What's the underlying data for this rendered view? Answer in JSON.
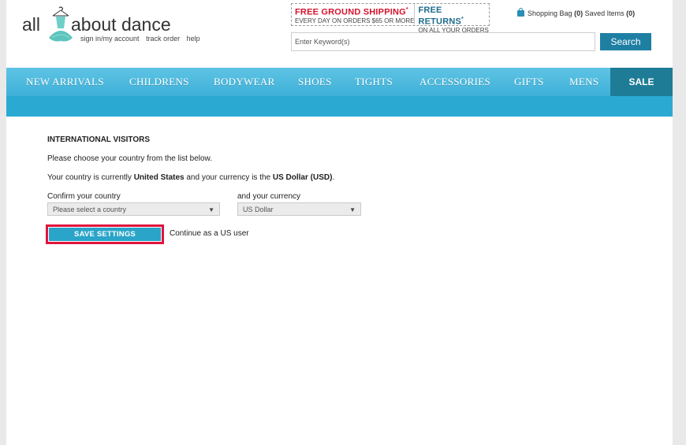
{
  "header": {
    "logo": {
      "left": "all",
      "right": "about dance"
    },
    "account_links": [
      "sign in/my account",
      "track order",
      "help"
    ],
    "promo": {
      "shipping_title": "FREE GROUND SHIPPING",
      "shipping_sub": "EVERY DAY ON ORDERS $65 OR MORE",
      "returns_title": "FREE RETURNS",
      "returns_sub": "ON ALL YOUR ORDERS",
      "mark": "*"
    },
    "bag": {
      "label": "Shopping Bag",
      "count": "(0)",
      "saved_label": "Saved Items",
      "saved_count": "(0)"
    },
    "search": {
      "placeholder": "Enter Keyword(s)",
      "button": "Search"
    }
  },
  "nav": {
    "items": [
      "NEW ARRIVALS",
      "CHILDRENS",
      "BODYWEAR",
      "SHOES",
      "TIGHTS",
      "ACCESSORIES",
      "GIFTS",
      "MENS"
    ],
    "sale": "SALE"
  },
  "content": {
    "heading": "INTERNATIONAL VISITORS",
    "instruction": "Please choose your country from the list below.",
    "current_prefix": "Your country is currently ",
    "current_country": "United States",
    "current_mid": " and your currency is the ",
    "current_currency": "US Dollar (USD)",
    "current_suffix": ".",
    "country_label": "Confirm your country",
    "country_value": "Please select a country",
    "currency_label": "and your currency",
    "currency_value": "US Dollar",
    "save_button": "SAVE SETTINGS",
    "continue_link": "Continue as a US user"
  },
  "colors": {
    "accent": "#2aa4c8",
    "highlight": "#e0143c",
    "sale_bg": "#1f7c97",
    "promo_red": "#d3132d",
    "promo_blue": "#1e6c8c"
  }
}
